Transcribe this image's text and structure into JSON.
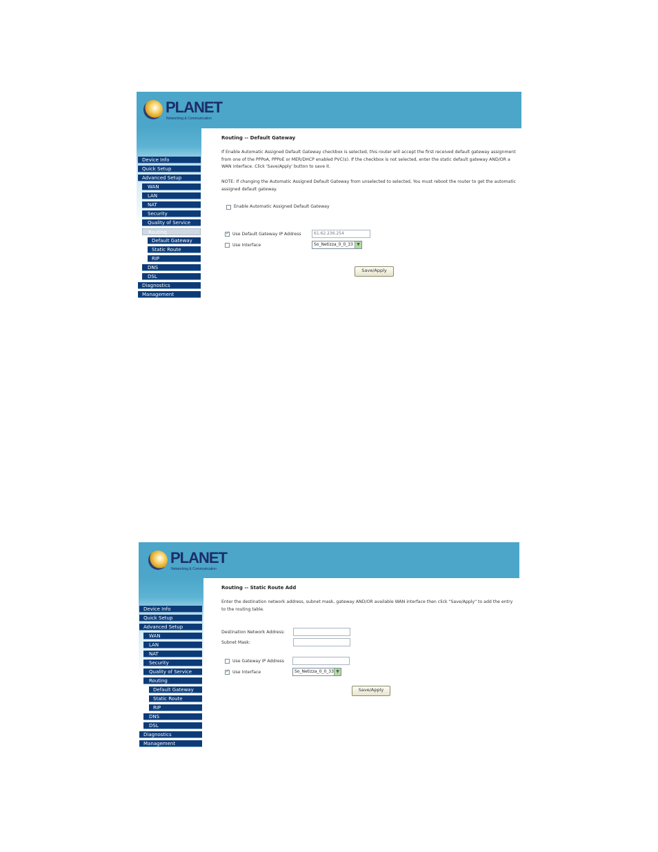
{
  "brand": {
    "name": "PLANET",
    "tagline": "Networking & Communication"
  },
  "menu": [
    {
      "label": "Device Info"
    },
    {
      "label": "Quick Setup"
    },
    {
      "label": "Advanced Setup"
    },
    {
      "label": "WAN"
    },
    {
      "label": "LAN"
    },
    {
      "label": "NAT"
    },
    {
      "label": "Security"
    },
    {
      "label": "Quality of Service"
    },
    {
      "label": "Routing"
    },
    {
      "label": "Default Gateway"
    },
    {
      "label": "Static Route"
    },
    {
      "label": "RIP"
    },
    {
      "label": "DNS"
    },
    {
      "label": "DSL"
    },
    {
      "label": "Diagnostics"
    },
    {
      "label": "Management"
    }
  ],
  "gateway": {
    "title": "Routing -- Default Gateway",
    "description": "If Enable Automatic Assigned Default Gateway checkbox is selected, this router will accept the first received default gateway assignment from one of the PPPoA, PPPoE or MER/DHCP enabled PVC(s). If the checkbox is not selected, enter the static default gateway AND/OR a WAN interface. Click 'Save/Apply' button to save it.",
    "note": "NOTE: If changing the Automatic Assigned Default Gateway from unselected to selected, You must reboot the router to get the automatic assigned default gateway.",
    "auto_label": "Enable Automatic Assigned Default Gateway",
    "use_ip_label": "Use Default Gateway IP Address",
    "ip_value": "61.62.236.254",
    "use_iface_label": "Use Interface",
    "iface_value": "So_Netizza_0_0_33",
    "save_label": "Save/Apply"
  },
  "static_route": {
    "title": "Routing -- Static Route Add",
    "description": "Enter the destination network address, subnet mask, gateway AND/OR available WAN interface then click \"Save/Apply\" to add the entry to the routing table.",
    "dest_label": "Destination Network Address:",
    "mask_label": "Subnet Mask:",
    "gw_label": "Use Gateway IP Address",
    "iface_label": "Use Interface",
    "iface_value": "So_Netizza_0_0_33",
    "save_label": "Save/Apply"
  }
}
